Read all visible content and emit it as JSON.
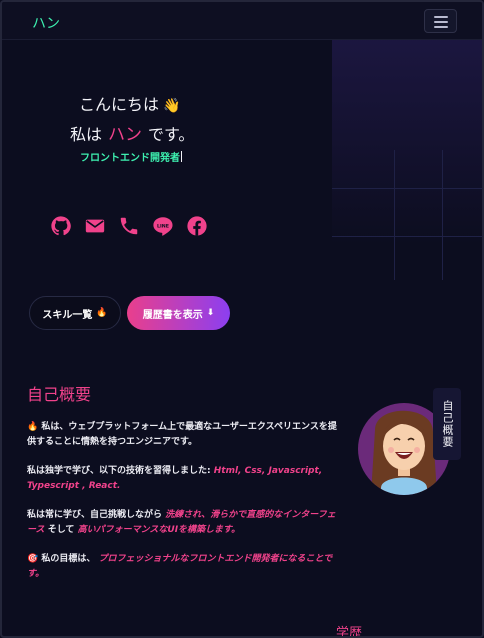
{
  "nav": {
    "brand": "ハン"
  },
  "hero": {
    "greeting": "こんにちは",
    "wave_emoji": "👋",
    "name_prefix": "私は",
    "name": "ハン",
    "name_suffix": "です。",
    "role": "フロントエンド開発者"
  },
  "socials": [
    {
      "icon": "github-icon"
    },
    {
      "icon": "mail-icon"
    },
    {
      "icon": "phone-icon"
    },
    {
      "icon": "line-icon"
    },
    {
      "icon": "facebook-icon"
    }
  ],
  "buttons": {
    "skills_label": "スキル一覧",
    "skills_icon": "🔥",
    "resume_label": "履歴書を表示",
    "resume_icon": "⬇"
  },
  "about": {
    "title": "自己概要",
    "side_tab": "自己概要",
    "p1_icon": "🔥",
    "p1": "私は、ウェブプラットフォーム上で最適なユーザーエクスペリエンスを提供することに情熱を持つエンジニアです。",
    "p2_a": "私は独学で学び、以下の技術を習得しました:",
    "p2_hl": "Html, Css, Javascript, Typescript , React.",
    "p3_a": "私は常に学び、自己挑戦しながら",
    "p3_hl1": "洗練され、滑らかで直感的なインターフェース",
    "p3_b": "そして",
    "p3_hl2": "高いパフォーマンスなUIを構築します。",
    "p4_icon": "🎯",
    "p4_a": "私の目標は、",
    "p4_hl": "プロフェッショナルなフロントエンド開発者になることです。"
  },
  "education": {
    "title": "学歴"
  },
  "colors": {
    "accent": "#f0428b",
    "brand": "#3df0b0",
    "bg": "#0c0d1f"
  }
}
